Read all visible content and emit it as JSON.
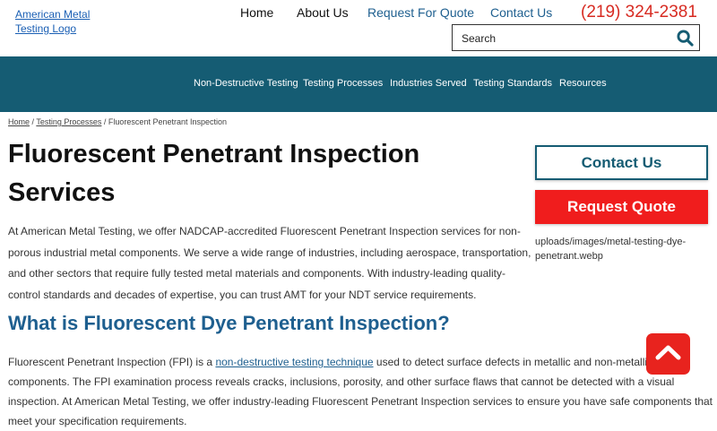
{
  "header": {
    "logo_alt": "American Metal Testing Logo",
    "nav": {
      "home": "Home",
      "about": "About Us",
      "quote": "Request For Quote",
      "contact": "Contact Us"
    },
    "phone": "(219) 324-2381",
    "search_placeholder": "Search"
  },
  "main_nav": [
    "Non-Destructive Testing",
    "Testing Processes",
    "Industries Served",
    "Testing Standards",
    "Resources"
  ],
  "breadcrumb": {
    "home": "Home",
    "sep": " / ",
    "parent": "Testing Processes",
    "current": "Fluorescent Penetrant Inspection"
  },
  "page_title": "Fluorescent Penetrant Inspection Services",
  "intro": "At American Metal Testing, we offer NADCAP-accredited Fluorescent Penetrant Inspection services for non-porous industrial metal components. We serve a wide range of industries, including aerospace, transportation, and other sectors that require fully tested metal materials and components. With industry-leading quality-control standards and decades of expertise, you can trust AMT for your NDT service requirements.",
  "section_heading": "What is Fluorescent Dye Penetrant Inspection?",
  "body2": {
    "before": "Fluorescent Penetrant Inspection (FPI) is a ",
    "link": "non-destructive testing technique",
    "after": " used to detect surface defects in metallic and non-metallic components. The FPI examination process reveals cracks, inclusions, porosity, and other surface flaws that cannot be detected with a visual inspection. At American Metal Testing, we offer industry-leading Fluorescent Penetrant Inspection services to ensure you have safe components that meet your specification requirements."
  },
  "sidebar": {
    "contact_button": "Contact Us",
    "quote_button": "Request Quote",
    "image_alt": "uploads/images/metal-testing-dye-penetrant.webp"
  },
  "colors": {
    "nav_bg": "#155c73",
    "accent_red": "#f01d1d",
    "link_blue": "#1e5f8f",
    "phone_red": "#d72b22"
  },
  "icons": {
    "search": "search-icon",
    "scroll_top": "chevron-up-icon"
  }
}
